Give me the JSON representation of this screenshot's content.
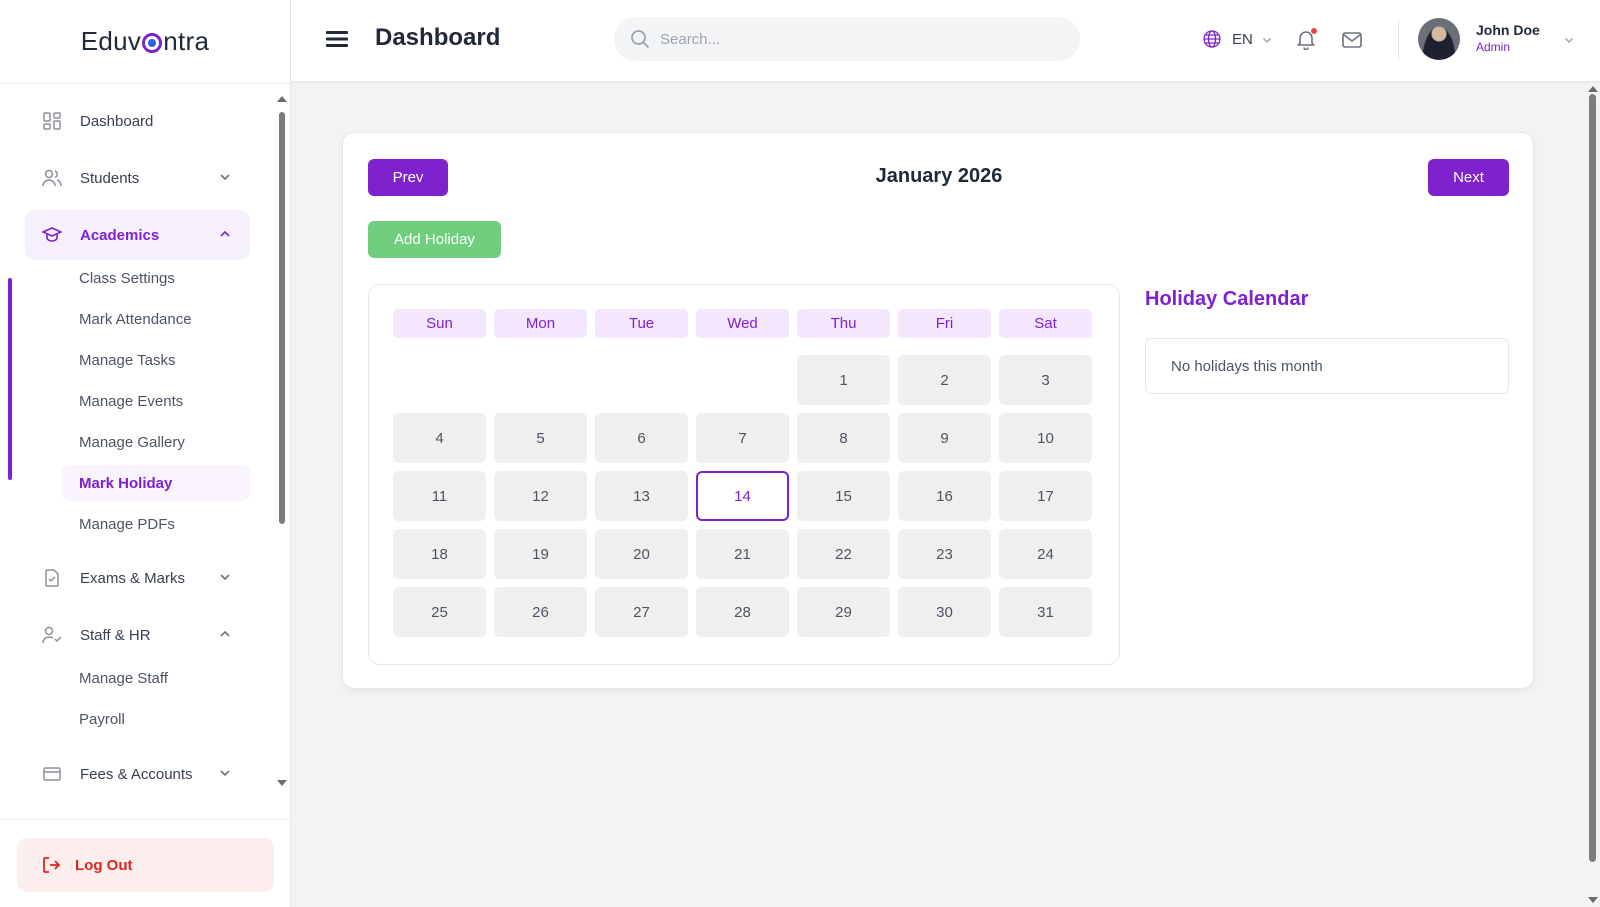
{
  "brand": {
    "name_pre": "Eduv",
    "name_post": "ntra"
  },
  "header": {
    "title": "Dashboard",
    "search_placeholder": "Search...",
    "language": "EN",
    "user_name": "John Doe",
    "user_role": "Admin"
  },
  "sidebar": {
    "dashboard": "Dashboard",
    "students": "Students",
    "academics": "Academics",
    "academics_sub": [
      "Class Settings",
      "Mark Attendance",
      "Manage Tasks",
      "Manage Events",
      "Manage Gallery",
      "Mark Holiday",
      "Manage PDFs"
    ],
    "exams": "Exams & Marks",
    "staff": "Staff & HR",
    "staff_sub": [
      "Manage Staff",
      "Payroll"
    ],
    "fees": "Fees & Accounts",
    "logout": "Log Out"
  },
  "calendar": {
    "prev_label": "Prev",
    "next_label": "Next",
    "month_label": "January 2026",
    "add_holiday_label": "Add Holiday",
    "weekdays": [
      "Sun",
      "Mon",
      "Tue",
      "Wed",
      "Thu",
      "Fri",
      "Sat"
    ],
    "first_weekday_index": 4,
    "days_in_month": 31,
    "today": 14
  },
  "holiday_panel": {
    "title": "Holiday Calendar",
    "empty_text": "No holidays this month"
  },
  "colors": {
    "accent": "#7e22ce",
    "success": "#6fcf7f",
    "danger": "#dc2626"
  }
}
